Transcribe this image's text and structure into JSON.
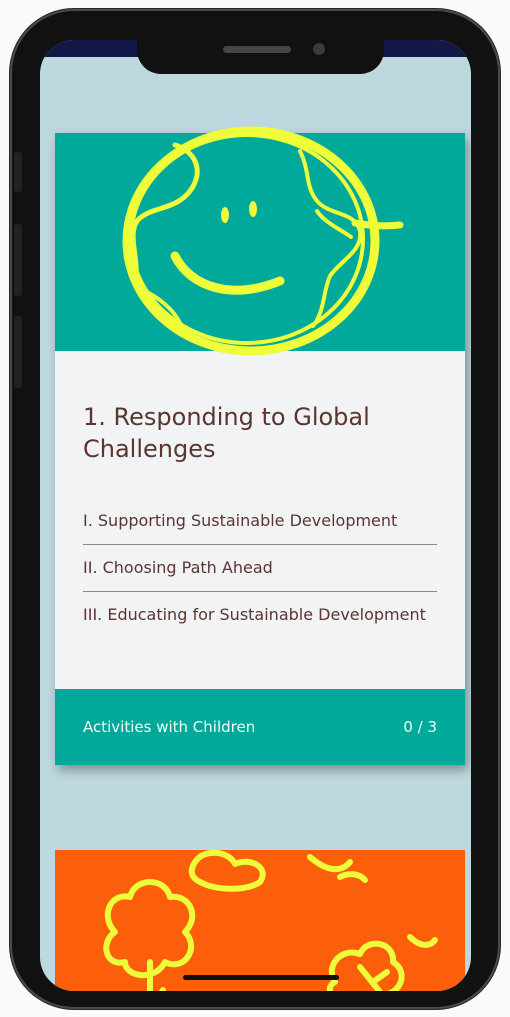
{
  "course": {
    "title": "1. Responding to Global Challenges",
    "lessons": [
      {
        "label": "I. Supporting Sustainable Development"
      },
      {
        "label": "II. Choosing Path Ahead"
      },
      {
        "label": "III. Educating for Sustainable Development"
      }
    ],
    "footer_label": "Activities with Children",
    "progress": "0 / 3",
    "hero_icon": "smiling-earth-icon"
  },
  "next_card": {
    "hero_icon": "trees-illustration-icon"
  },
  "colors": {
    "screen_bg": "#bed8df",
    "teal": "#00a99a",
    "orange": "#fb5f0b",
    "doodle": "#eefc3a",
    "text": "#5b3530"
  }
}
